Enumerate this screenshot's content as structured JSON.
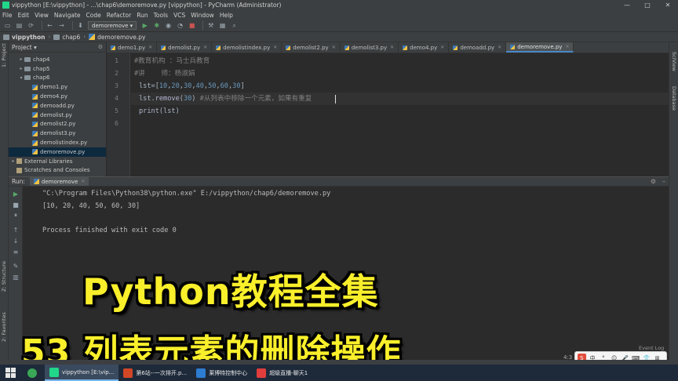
{
  "window": {
    "title": "vippython [E:\\vippython] - ...\\chap6\\demoremove.py [vippython] - PyCharm (Administrator)",
    "controls": [
      "—",
      "□",
      "✕"
    ]
  },
  "menu": [
    "File",
    "Edit",
    "View",
    "Navigate",
    "Code",
    "Refactor",
    "Run",
    "Tools",
    "VCS",
    "Window",
    "Help"
  ],
  "toolbar": {
    "run_config": "demoremove ▾"
  },
  "breadcrumb": [
    "vippython",
    "chap6",
    "demoremove.py"
  ],
  "left_strip": {
    "project_label": "1: Project",
    "structure_label": "Z: Structure",
    "favorites_label": "2: Favorites"
  },
  "right_strip": {
    "sciview_label": "SciView",
    "database_label": "Database"
  },
  "project": {
    "header": "Project ▾",
    "tree": [
      {
        "label": "chap4",
        "type": "folder",
        "indent": 1,
        "expanded": false
      },
      {
        "label": "chap5",
        "type": "folder",
        "indent": 1,
        "expanded": false
      },
      {
        "label": "chap6",
        "type": "folder",
        "indent": 1,
        "expanded": true
      },
      {
        "label": "demo1.py",
        "type": "py",
        "indent": 2
      },
      {
        "label": "demo4.py",
        "type": "py",
        "indent": 2
      },
      {
        "label": "demoadd.py",
        "type": "py",
        "indent": 2
      },
      {
        "label": "demolist.py",
        "type": "py",
        "indent": 2
      },
      {
        "label": "demolist2.py",
        "type": "py",
        "indent": 2
      },
      {
        "label": "demolist3.py",
        "type": "py",
        "indent": 2
      },
      {
        "label": "demolistindex.py",
        "type": "py",
        "indent": 2
      },
      {
        "label": "demoremove.py",
        "type": "py",
        "indent": 2,
        "selected": true
      },
      {
        "label": "External Libraries",
        "type": "lib",
        "indent": 0,
        "expanded": false
      },
      {
        "label": "Scratches and Consoles",
        "type": "lib",
        "indent": 0
      }
    ]
  },
  "tabs": [
    {
      "label": "demo1.py",
      "active": false
    },
    {
      "label": "demolist.py",
      "active": false
    },
    {
      "label": "demolistindex.py",
      "active": false
    },
    {
      "label": "demolist2.py",
      "active": false
    },
    {
      "label": "demolist3.py",
      "active": false
    },
    {
      "label": "demo4.py",
      "active": false
    },
    {
      "label": "demoadd.py",
      "active": false
    },
    {
      "label": "demoremove.py",
      "active": true
    }
  ],
  "editor": {
    "line_numbers": [
      "1",
      "2",
      "3",
      "4",
      "5",
      "6"
    ],
    "lines": {
      "l1": "#教育机构 ：马士兵教育",
      "l2": "#讲    师：杨淑娟",
      "l3_a": "lst=[",
      "l3_nums": [
        "10",
        "20",
        "30",
        "40",
        "50",
        "60",
        "30"
      ],
      "l3_b": "]",
      "l4_a": "lst.",
      "l4_method": "remove",
      "l4_b": "(",
      "l4_num": "30",
      "l4_c": ") ",
      "l4_comment": "#从列表中移除一个元素，如果有重复",
      "l5": "print(lst)"
    }
  },
  "run_panel": {
    "label": "Run:",
    "tab": "demoremove",
    "output": [
      "\"C:\\Program Files\\Python38\\python.exe\" E:/vippython/chap6/demoremove.py",
      "[10, 20, 40, 50, 60, 30]",
      "",
      "Process finished with exit code 0"
    ]
  },
  "caption": {
    "line1": "Python教程全集",
    "line2": "53 列表元素的删除操作",
    "color": "#f9ef2b"
  },
  "status": {
    "position": "4:3",
    "event_log": "Event Log"
  },
  "ime": [
    "S",
    "中",
    "°",
    "☺",
    "🎤",
    "⌨",
    "👕",
    "⊞"
  ],
  "taskbar": {
    "apps": [
      {
        "label": "vippython [E:\\vip...",
        "active": true,
        "color": "#21d789"
      },
      {
        "label": "第6站--一次排开.p...",
        "active": false,
        "color": "#d24726"
      },
      {
        "label": "莱博特控制中心",
        "active": false,
        "color": "#2d7dd2"
      },
      {
        "label": "超级直播-聊天1",
        "active": false,
        "color": "#e23d3d"
      }
    ]
  }
}
